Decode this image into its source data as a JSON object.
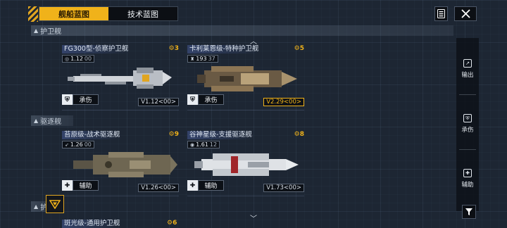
{
  "tabs": [
    {
      "label": "舰船蓝图",
      "active": true
    },
    {
      "label": "技术蓝图",
      "active": false
    }
  ],
  "top_buttons": {
    "list_icon": "list-icon",
    "close_icon": "close-icon"
  },
  "sections": {
    "frigate": {
      "label": "护卫舰"
    },
    "destroyer": {
      "label": "驱逐舰"
    },
    "next": {
      "label": "护"
    }
  },
  "cards": [
    {
      "title": "FG300型-侦察护卫舰",
      "badge": "3",
      "stat_main": "1.12",
      "stat_sub": "00",
      "role": "承伤",
      "role_icon": "shield-icon",
      "version": "V1.12<00>",
      "version_gold": false
    },
    {
      "title": "卡利莱恩级-特种护卫舰",
      "badge": "5",
      "stat_main": "193",
      "stat_sub": "37",
      "role": "承伤",
      "role_icon": "shield-icon",
      "version": "V2.29<00>",
      "version_gold": true
    },
    {
      "title": "苔原级-战术驱逐舰",
      "badge": "9",
      "stat_main": "1.26",
      "stat_sub": "00",
      "role": "辅助",
      "role_icon": "support-icon",
      "version": "V1.26<00>",
      "version_gold": false
    },
    {
      "title": "谷神星级-支援驱逐舰",
      "badge": "8",
      "stat_main": "1.61",
      "stat_sub": "12",
      "role": "辅助",
      "role_icon": "support-icon",
      "version": "V1.73<00>",
      "version_gold": false
    }
  ],
  "partial_card": {
    "title": "斑光级-通用护卫舰",
    "badge": "6"
  },
  "right_panel": [
    {
      "label": "输出",
      "icon": "output-icon"
    },
    {
      "label": "承伤",
      "icon": "shield-icon"
    },
    {
      "label": "辅助",
      "icon": "support-icon"
    }
  ],
  "colors": {
    "accent": "#f0b21a",
    "background": "#1d2633",
    "panel": "#0c0f14"
  }
}
